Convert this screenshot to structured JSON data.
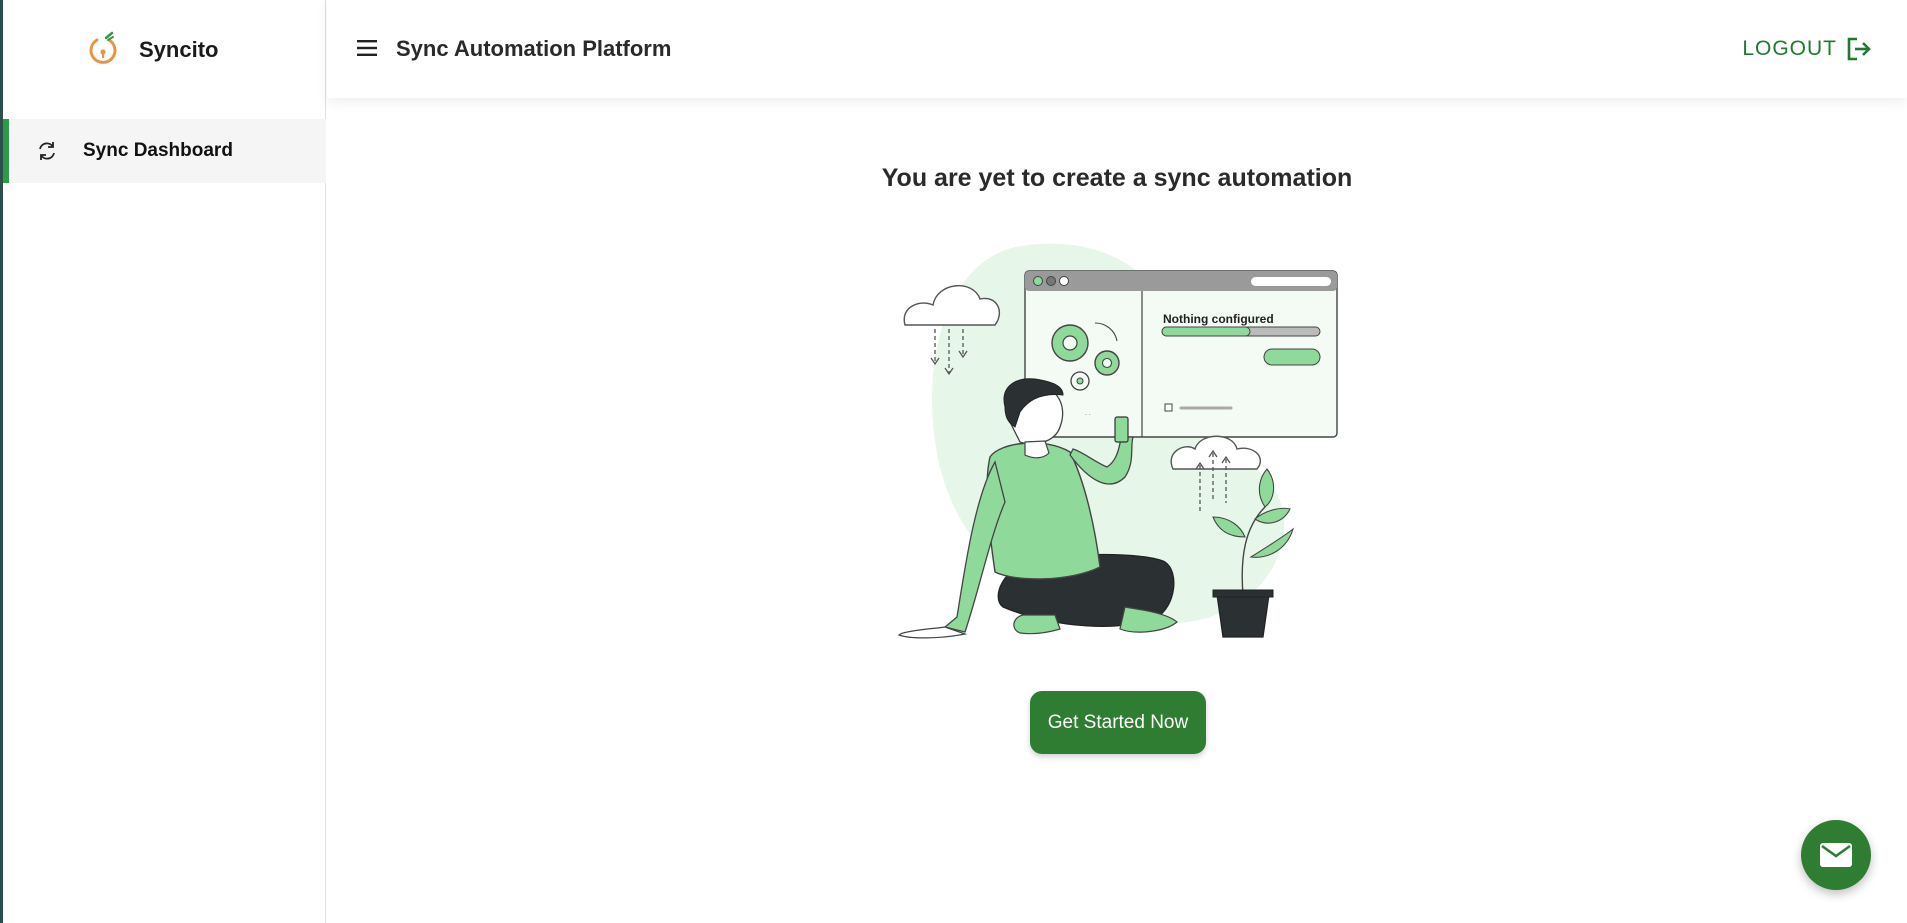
{
  "sidebar": {
    "brand_name": "Syncito",
    "items": [
      {
        "label": "Sync Dashboard",
        "icon": "sync-icon",
        "active": true
      }
    ]
  },
  "header": {
    "title": "Sync Automation Platform",
    "logout_label": "LOGOUT",
    "menu_icon": "hamburger-menu-icon",
    "logout_icon": "logout-icon"
  },
  "main": {
    "empty_title": "You are yet to create a sync automation",
    "illustration_text": "Nothing configured",
    "cta_label": "Get Started Now"
  },
  "fab": {
    "icon": "mail-icon"
  },
  "colors": {
    "accent_green": "#2e7d32",
    "light_green": "#8fd99a",
    "pale_green": "#e6f7ea",
    "active_bar": "#2e9a48",
    "logout_text": "#1f7a2e"
  }
}
